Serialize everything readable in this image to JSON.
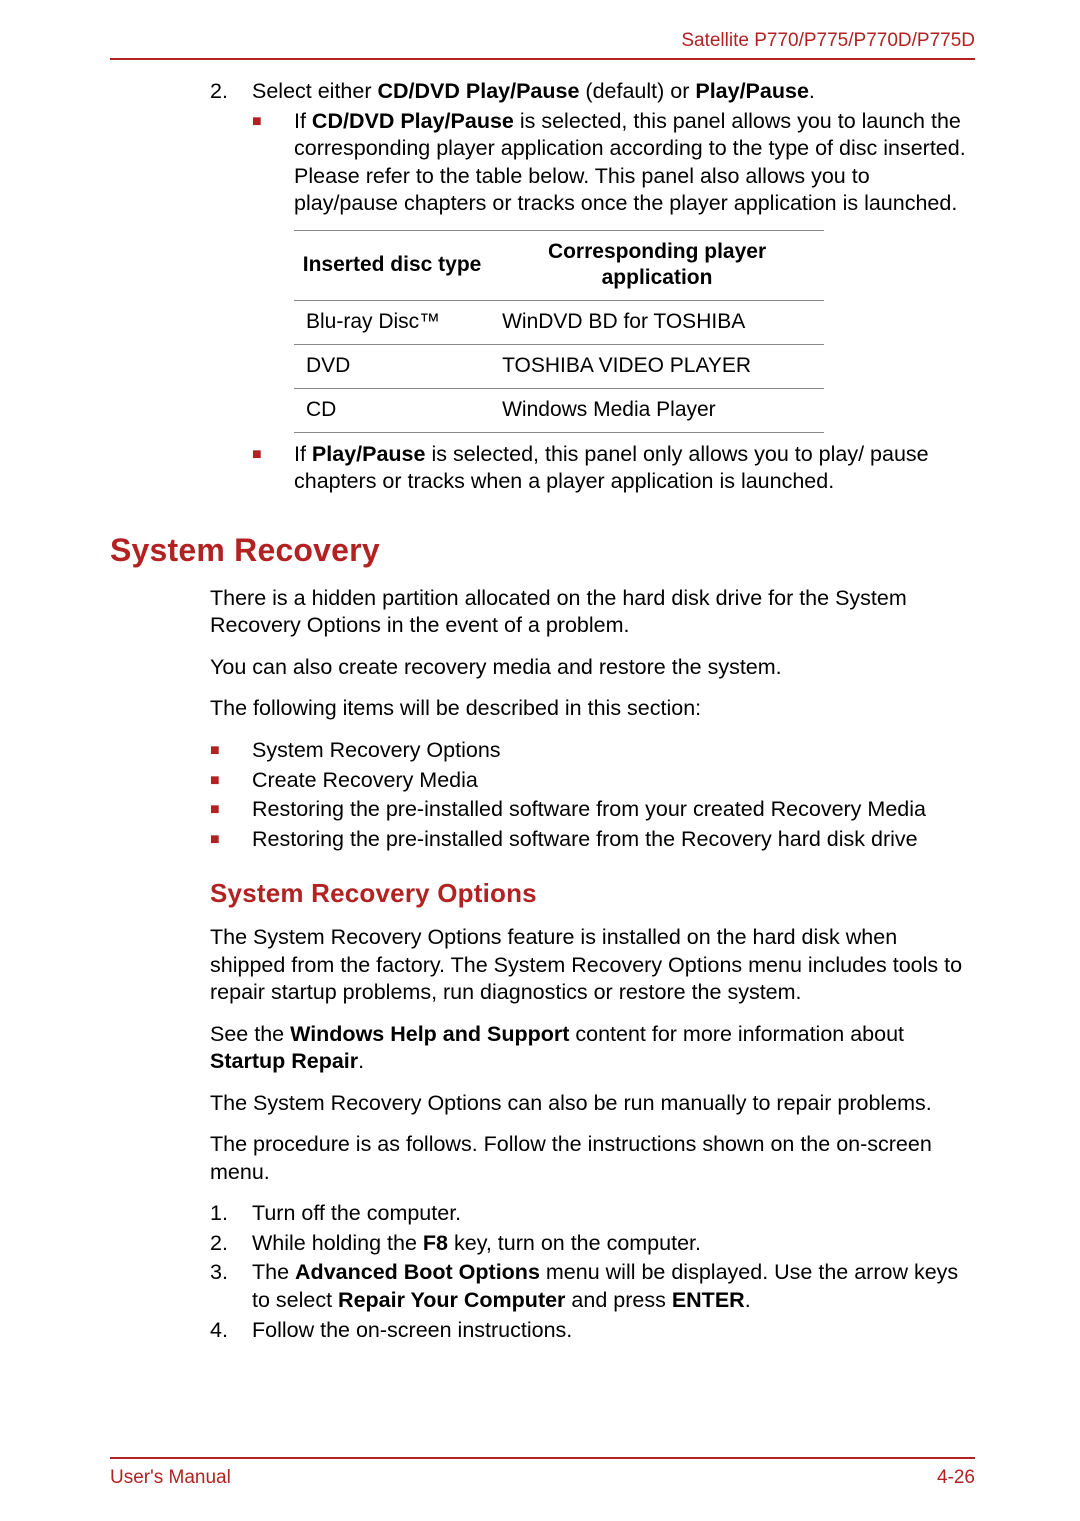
{
  "header": {
    "model": "Satellite P770/P775/P770D/P775D"
  },
  "step2": {
    "num": "2.",
    "prefix": "Select either ",
    "b1": "CD/DVD Play/Pause",
    "mid1": " (default) or ",
    "b2": "Play/Pause",
    "suffix": "."
  },
  "subbullet1": {
    "prefix": "If ",
    "b1": "CD/DVD Play/Pause",
    "rest": " is selected, this panel allows you to launch the corresponding player application according to the type of disc inserted. Please refer to the table below. This panel also allows you to play/pause chapters or tracks once the player application is launched."
  },
  "table": {
    "h1": "Inserted disc type",
    "h2": "Corresponding player application",
    "rows": [
      {
        "c1": "Blu-ray Disc™",
        "c2": "WinDVD BD for TOSHIBA"
      },
      {
        "c1": "DVD",
        "c2": "TOSHIBA VIDEO PLAYER"
      },
      {
        "c1": "CD",
        "c2": "Windows Media Player"
      }
    ]
  },
  "subbullet2": {
    "prefix": "If ",
    "b1": "Play/Pause",
    "rest": " is selected, this panel only allows you to play/ pause chapters or tracks when a player application is launched."
  },
  "h1": "System Recovery",
  "para1": "There is a hidden partition allocated on the hard disk drive for the System Recovery Options in the event of a problem.",
  "para2": "You can also create recovery media and restore the system.",
  "para3": "The following items will be described in this section:",
  "list1": [
    "System Recovery Options",
    "Create Recovery Media",
    "Restoring the pre-installed software from your created Recovery Media",
    "Restoring the pre-installed software from the Recovery hard disk drive"
  ],
  "h2": "System Recovery Options",
  "para4": "The System Recovery Options feature is installed on the hard disk when shipped from the factory. The System Recovery Options menu includes tools to repair startup problems, run diagnostics or restore the system.",
  "para5": {
    "t1": "See the ",
    "b1": "Windows Help and Support",
    "t2": " content for more information about ",
    "b2": "Startup Repair",
    "t3": "."
  },
  "para6": "The System Recovery Options can also be run manually to repair problems.",
  "para7": "The procedure is as follows. Follow the instructions shown on the on-screen menu.",
  "steps": [
    {
      "n": "1.",
      "text_plain": "Turn off the computer."
    },
    {
      "n": "2.",
      "t1": "While holding the ",
      "b1": "F8",
      "t2": " key, turn on the computer."
    },
    {
      "n": "3.",
      "t1": "The ",
      "b1": "Advanced Boot Options",
      "t2": " menu will be displayed. Use the arrow keys to select ",
      "b2": "Repair Your Computer",
      "t3": " and press ",
      "b3": "ENTER",
      "t4": "."
    },
    {
      "n": "4.",
      "text_plain": "Follow the on-screen instructions."
    }
  ],
  "footer": {
    "left": "User's Manual",
    "right": "4-26"
  }
}
